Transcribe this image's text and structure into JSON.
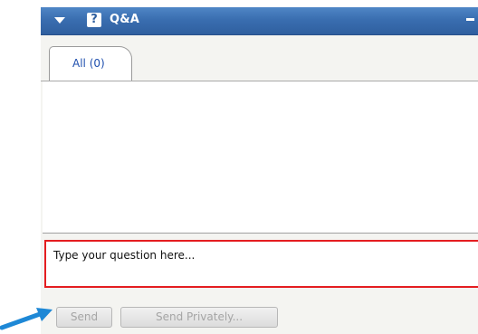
{
  "panel": {
    "title": "Q&A",
    "help_icon_glyph": "?",
    "icons": [
      "collapse-arrow-icon",
      "help-icon",
      "minimize-icon"
    ],
    "colors": {
      "titlebar": "#3a6eb0",
      "tab_label": "#1f4fae",
      "highlight": "#e41d20",
      "annotation_arrow": "#1e88d6"
    }
  },
  "tabs": [
    {
      "label": "All (0)"
    }
  ],
  "question_input": {
    "placeholder": "Type your question here..."
  },
  "buttons": {
    "send_label": "Send",
    "send_privately_label": "Send Privately..."
  }
}
